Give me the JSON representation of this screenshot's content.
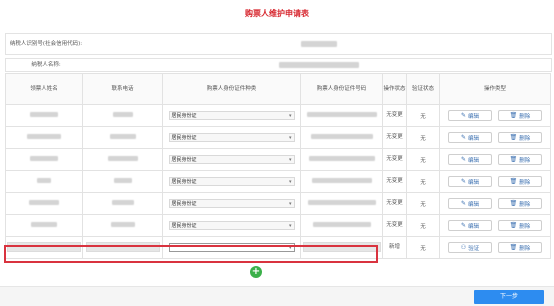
{
  "page_title": "购票人维护申请表",
  "taxpayer": {
    "id_label": "纳税人识别号(社会信用代码):",
    "name_label": "纳税人名称:"
  },
  "table": {
    "headers": [
      "领票人姓名",
      "联系电话",
      "购票人身份证件种类",
      "购票人身份证件号码",
      "操作状态",
      "验证状态",
      "操作类型"
    ],
    "rows": [
      {
        "id_type": "居民身份证",
        "op_state": "无变更",
        "verify_state": "无",
        "btn1": "编辑",
        "btn2": "删除"
      },
      {
        "id_type": "居民身份证",
        "op_state": "无变更",
        "verify_state": "无",
        "btn1": "编辑",
        "btn2": "删除"
      },
      {
        "id_type": "居民身份证",
        "op_state": "无变更",
        "verify_state": "无",
        "btn1": "编辑",
        "btn2": "删除"
      },
      {
        "id_type": "居民身份证",
        "op_state": "无变更",
        "verify_state": "无",
        "btn1": "编辑",
        "btn2": "删除"
      },
      {
        "id_type": "居民身份证",
        "op_state": "无变更",
        "verify_state": "无",
        "btn1": "编辑",
        "btn2": "删除"
      },
      {
        "id_type": "居民身份证",
        "op_state": "无变更",
        "verify_state": "无",
        "btn1": "编辑",
        "btn2": "删除"
      }
    ],
    "new_row": {
      "id_type": "",
      "op_state": "新增",
      "verify_state": "无",
      "btn1": "验证",
      "btn2": "删除"
    }
  },
  "add_icon": "plus-circle-icon",
  "next_button": "下一步",
  "colors": {
    "title": "#d7262e",
    "accent": "#2d8cf0",
    "add": "#3bb04a",
    "highlight": "#d9333f"
  }
}
